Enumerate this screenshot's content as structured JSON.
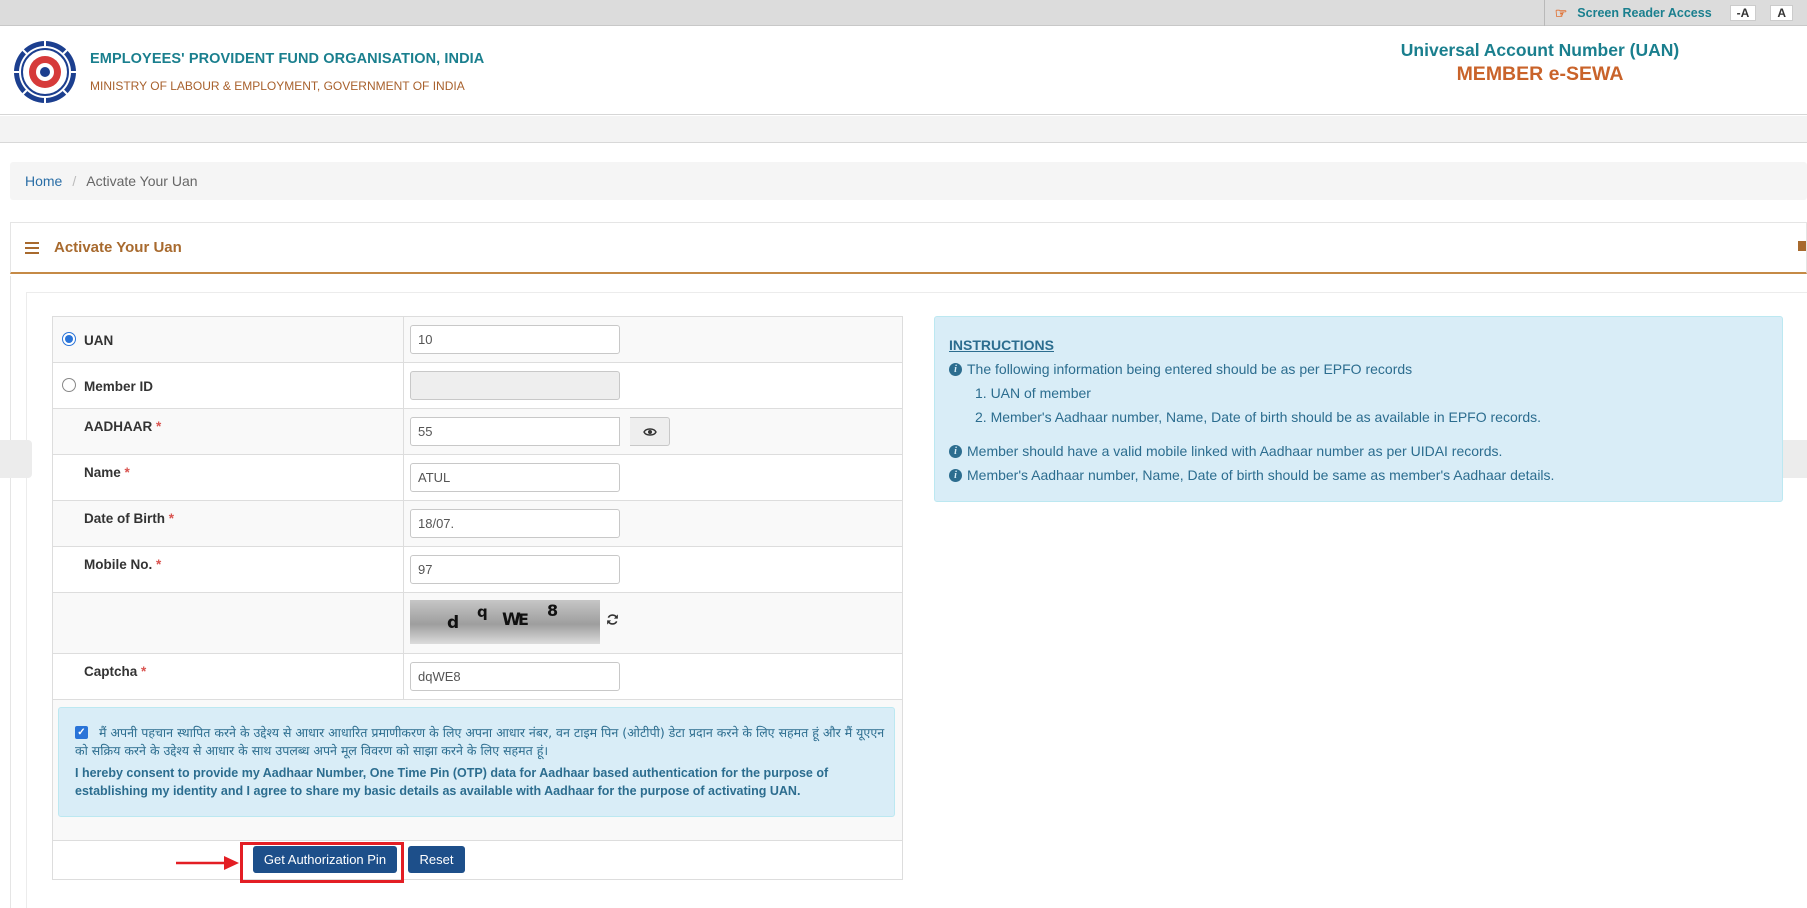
{
  "topbar": {
    "screen_reader": "Screen Reader Access",
    "font_decrease": "-A",
    "font_normal": "A"
  },
  "header": {
    "org_name": "EMPLOYEES' PROVIDENT FUND ORGANISATION, INDIA",
    "ministry": "MINISTRY OF LABOUR & EMPLOYMENT, GOVERNMENT OF INDIA",
    "uan_title": "Universal Account Number (UAN)",
    "esewa_title": "MEMBER e-SEWA"
  },
  "breadcrumb": {
    "home": "Home",
    "separator": "/",
    "current": "Activate Your Uan"
  },
  "panel": {
    "title": "Activate Your Uan"
  },
  "form": {
    "uan": {
      "label": "UAN",
      "value": "10",
      "selected": true
    },
    "member_id": {
      "label": "Member ID",
      "value": "",
      "selected": false
    },
    "aadhaar": {
      "label": "AADHAAR",
      "value": "55"
    },
    "name": {
      "label": "Name",
      "value": "ATUL"
    },
    "dob": {
      "label": "Date of Birth",
      "value": "18/07."
    },
    "mobile": {
      "label": "Mobile No.",
      "value": "97"
    },
    "captcha": {
      "label": "Captcha",
      "value": "dqWE8",
      "image_chars": [
        "d",
        "q",
        "W",
        "E",
        "8"
      ]
    },
    "required_mark": "*",
    "consent": {
      "checked": true,
      "hindi": "मैं अपनी पहचान स्थापित करने के उद्देश्य से आधार आधारित प्रमाणीकरण के लिए अपना आधार नंबर, वन टाइम पिन (ओटीपी) डेटा प्रदान करने के लिए सहमत हूं और मैं यूएएन को सक्रिय करने के उद्देश्य से आधार के साथ उपलब्ध अपने मूल विवरण को साझा करने के लिए सहमत हूं।",
      "english": "I hereby consent to provide my Aadhaar Number, One Time Pin (OTP) data for Aadhaar based authentication for the purpose of establishing my identity and I agree to share my basic details as available with Aadhaar for the purpose of activating UAN."
    },
    "buttons": {
      "get_pin": "Get Authorization Pin",
      "reset": "Reset"
    }
  },
  "instructions": {
    "title": "INSTRUCTIONS",
    "line1": "The following information being entered should be as per EPFO records",
    "sub1": "1. UAN of member",
    "sub2": "2. Member's Aadhaar number, Name, Date of birth should be as available in EPFO records.",
    "line2": "Member should have a valid mobile linked with Aadhaar number as per UIDAI records.",
    "line3": "Member's Aadhaar number, Name, Date of birth should be same as member's Aadhaar details."
  },
  "colors": {
    "teal": "#1a7f8e",
    "orange": "#c9632a",
    "button_blue": "#1d4f8a",
    "info_bg": "#d9edf7",
    "annotation_red": "#e31e24"
  }
}
